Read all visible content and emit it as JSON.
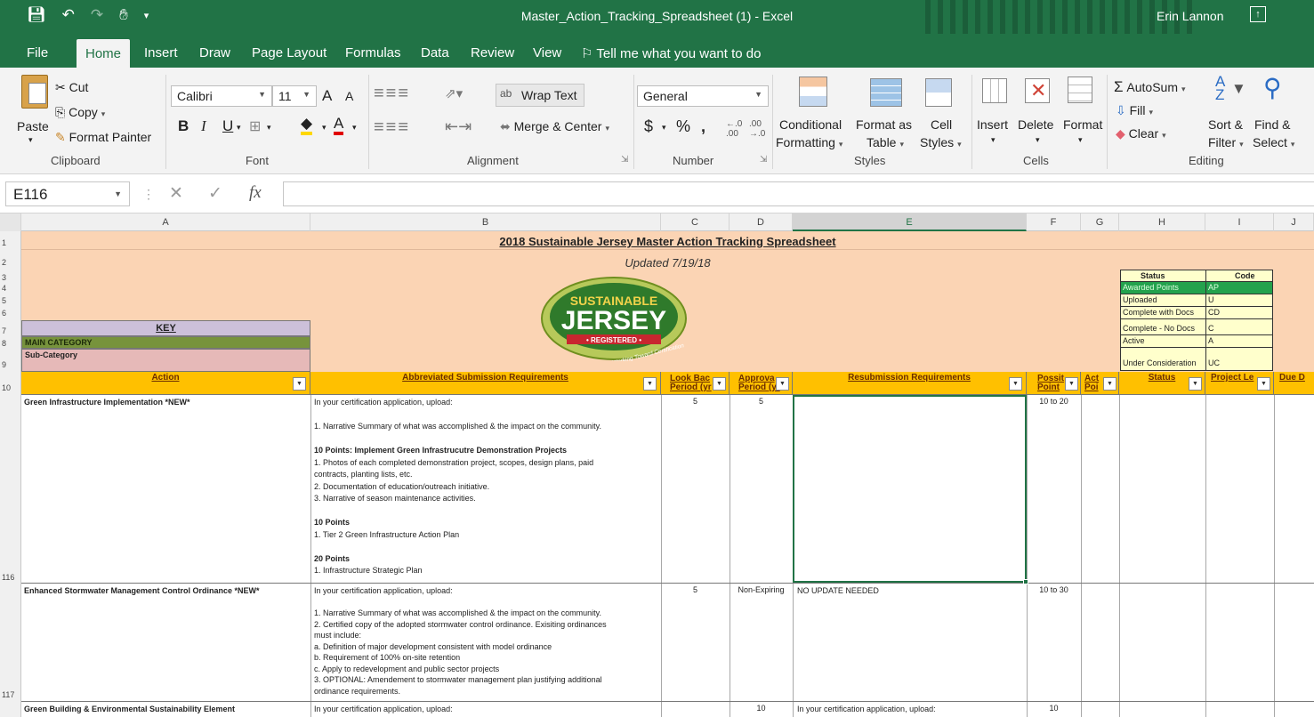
{
  "window": {
    "title": "Master_Action_Tracking_Spreadsheet (1)  -  Excel",
    "user": "Erin Lannon"
  },
  "ribbon_tabs": [
    "File",
    "Home",
    "Insert",
    "Draw",
    "Page Layout",
    "Formulas",
    "Data",
    "Review",
    "View"
  ],
  "tell_me": "Tell me what you want to do",
  "clipboard": {
    "paste": "Paste",
    "cut": "Cut",
    "copy": "Copy",
    "format_painter": "Format Painter",
    "label": "Clipboard"
  },
  "font": {
    "name": "Calibri",
    "size": "11",
    "bold": "B",
    "italic": "I",
    "underline": "U",
    "grow": "A",
    "shrink": "A",
    "label": "Font"
  },
  "alignment": {
    "wrap_text": "Wrap Text",
    "merge_center": "Merge & Center",
    "label": "Alignment"
  },
  "number": {
    "format": "General",
    "currency": "$",
    "percent": "%",
    "comma": ",",
    "label": "Number"
  },
  "styles": {
    "conditional": [
      "Conditional",
      "Formatting"
    ],
    "format_as": [
      "Format as",
      "Table"
    ],
    "cell_styles": [
      "Cell",
      "Styles"
    ],
    "label": "Styles"
  },
  "cells": {
    "insert": "Insert",
    "delete": "Delete",
    "format": "Format",
    "label": "Cells"
  },
  "editing": {
    "autosum": "AutoSum",
    "fill": "Fill",
    "clear": "Clear",
    "sort": [
      "Sort &",
      "Filter"
    ],
    "find": [
      "Find &",
      "Select"
    ],
    "label": "Editing"
  },
  "formula_bar": {
    "name_box": "E116",
    "fx": "fx",
    "value": ""
  },
  "columns": [
    "A",
    "B",
    "C",
    "D",
    "E",
    "F",
    "G",
    "H",
    "I",
    "J"
  ],
  "rows": [
    "1",
    "2",
    "3",
    "4",
    "5",
    "6",
    "7",
    "8",
    "9",
    "10",
    "116",
    "117"
  ],
  "sheet": {
    "title": "2018 Sustainable Jersey Master Action Tracking Spreadsheet",
    "updated": "Updated 7/19/18",
    "logo": {
      "line1": "SUSTAINABLE",
      "line2": "JERSEY",
      "registered": "• REGISTERED •",
      "arc": "Working Toward Certification"
    },
    "key": {
      "title": "KEY",
      "main": "MAIN CATEGORY",
      "sub": "Sub-Category"
    },
    "legend": {
      "head_status": "Status",
      "head_code": "Code",
      "rows": [
        {
          "status": "Awarded Points",
          "code": "AP",
          "color": "#23a24d"
        },
        {
          "status": "Uploaded",
          "code": "U",
          "color": "#ffffcc"
        },
        {
          "status": "Complete with Docs",
          "code": "CD",
          "color": "#ffffcc"
        },
        {
          "status": "Complete - No Docs",
          "code": "C",
          "color": "#ffffcc"
        },
        {
          "status": "Active",
          "code": "A",
          "color": "#ffffcc"
        },
        {
          "status": "Under Consideration",
          "code": "UC",
          "color": "#ffffcc"
        }
      ]
    },
    "headers": {
      "action": "Action",
      "abbrev": "Abbreviated Submission Requirements",
      "lookback": [
        "Look Bac",
        "Period (yr"
      ],
      "approval": [
        "Approva",
        "Period (yr"
      ],
      "resub": "Resubmission Requirements",
      "possible": [
        "Possit",
        "Point"
      ],
      "actual": [
        "Act",
        "Poi"
      ],
      "status": "Status",
      "project": "Project Le",
      "due": "Due D"
    },
    "row116": {
      "action": "Green Infrastructure Implementation *NEW*",
      "lines": [
        {
          "t": "In your certification application, upload:",
          "b": false
        },
        {
          "t": "",
          "b": false
        },
        {
          "t": "1.  Narrative Summary of what was accomplished & the impact on the community.",
          "b": false
        },
        {
          "t": "",
          "b": false
        },
        {
          "t": "10 Points: Implement Green Infrastrucutre Demonstration Projects",
          "b": true
        },
        {
          "t": "1. Photos of each completed demonstration project, scopes, design plans, paid",
          "b": false
        },
        {
          "t": "contracts, planting lists, etc.",
          "b": false
        },
        {
          "t": "2. Documentation of education/outreach initiative.",
          "b": false
        },
        {
          "t": "3. Narrative of season maintenance activities.",
          "b": false
        },
        {
          "t": "",
          "b": false
        },
        {
          "t": "10 Points",
          "b": true
        },
        {
          "t": "1. Tier 2 Green Infrastructure Action Plan",
          "b": false
        },
        {
          "t": "",
          "b": false
        },
        {
          "t": "20 Points",
          "b": true
        },
        {
          "t": "1. Infrastructure Strategic Plan",
          "b": false
        }
      ],
      "lookback": "5",
      "approval": "5",
      "resub": "",
      "possible": "10 to 20"
    },
    "row117": {
      "action": "Enhanced Stormwater Management Control Ordinance *NEW*",
      "lines": [
        "In your certification application, upload:",
        "",
        "1.  Narrative Summary of what was accomplished & the impact on the community.",
        "2. Certified copy of the adopted stormwater control ordinance.  Exisiting ordinances",
        "must include:",
        "     a. Definition of major development consistent with model ordinance",
        "     b. Requirement of 100% on-site retention",
        "     c. Apply to redevelopment and public sector projects",
        "3. OPTIONAL: Amendement to stormwater management plan justifying additional",
        "ordinance requirements."
      ],
      "lookback": "5",
      "approval": "Non-Expiring",
      "resub": "NO UPDATE NEEDED",
      "possible": "10 to 30"
    },
    "row118": {
      "action": "Green Building & Environmental Sustainability Element",
      "abbrev": "In your certification application, upload:",
      "approval": "10",
      "resub": "In your certification application, upload:",
      "possible": "10"
    }
  }
}
